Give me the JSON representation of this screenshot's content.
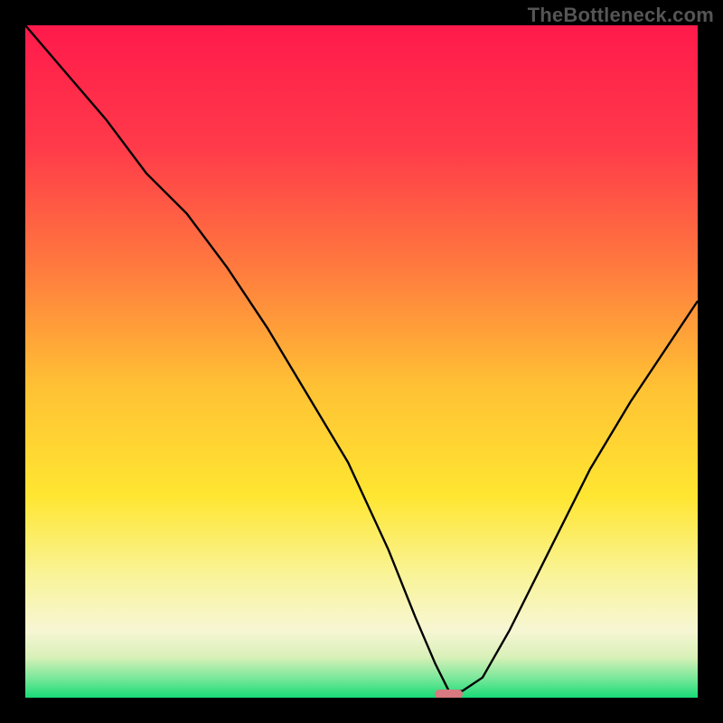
{
  "watermark": "TheBottleneck.com",
  "chart_data": {
    "type": "line",
    "title": "",
    "xlabel": "",
    "ylabel": "",
    "xlim": [
      0,
      100
    ],
    "ylim": [
      0,
      100
    ],
    "gradient_stops": [
      {
        "offset": 0,
        "color": "#ff1a4b"
      },
      {
        "offset": 18,
        "color": "#ff3a4a"
      },
      {
        "offset": 36,
        "color": "#ff7a3e"
      },
      {
        "offset": 54,
        "color": "#ffc234"
      },
      {
        "offset": 70,
        "color": "#ffe631"
      },
      {
        "offset": 82,
        "color": "#f9f49a"
      },
      {
        "offset": 90,
        "color": "#f7f6d4"
      },
      {
        "offset": 94,
        "color": "#d8f0b8"
      },
      {
        "offset": 97,
        "color": "#7de89b"
      },
      {
        "offset": 100,
        "color": "#18db77"
      }
    ],
    "series": [
      {
        "name": "bottleneck-curve",
        "x": [
          0,
          6,
          12,
          18,
          24,
          30,
          36,
          42,
          48,
          54,
          58,
          61,
          63,
          65,
          68,
          72,
          78,
          84,
          90,
          96,
          100
        ],
        "y": [
          100,
          93,
          86,
          78,
          72,
          64,
          55,
          45,
          35,
          22,
          12,
          5,
          1,
          1,
          3,
          10,
          22,
          34,
          44,
          53,
          59
        ]
      }
    ],
    "marker": {
      "x": 63,
      "y": 0.5,
      "width": 4.2,
      "height": 1.4,
      "color": "#d87a7f"
    }
  }
}
